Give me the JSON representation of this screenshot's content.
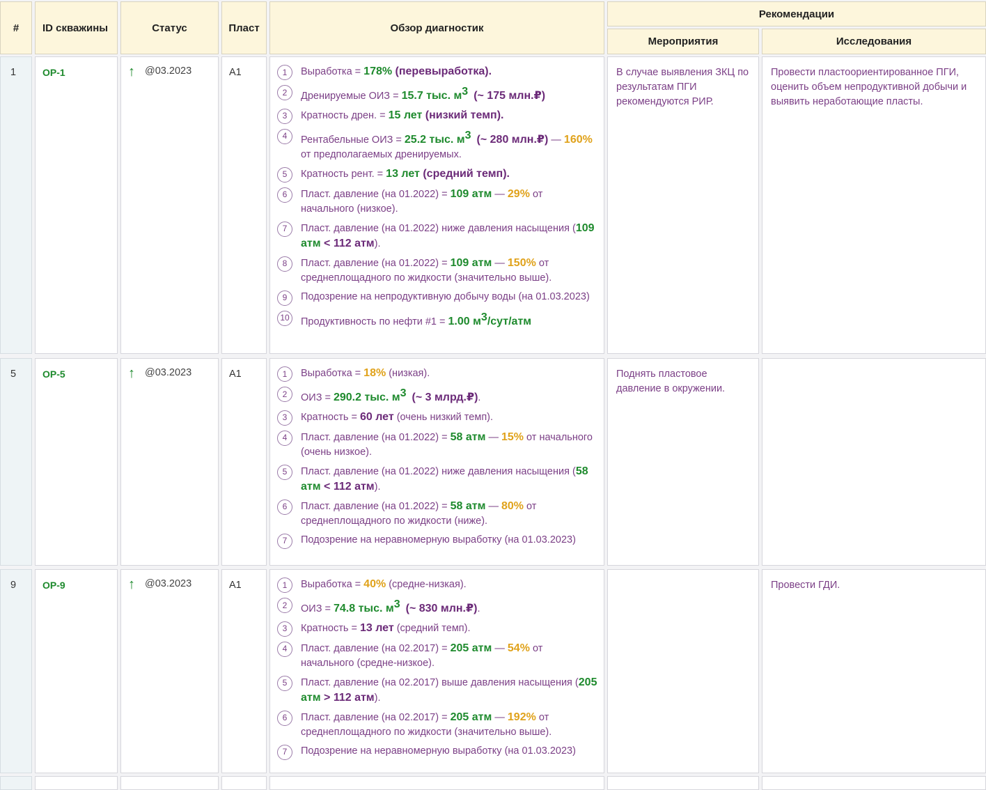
{
  "header": {
    "num": "#",
    "id": "ID скважины",
    "status": "Статус",
    "plast": "Пласт",
    "diag": "Обзор диагностик",
    "rec": "Рекомендации",
    "rec_events": "Мероприятия",
    "rec_research": "Исследования"
  },
  "rows": [
    {
      "num": "1",
      "id": "OP-1",
      "status_date": "@03.2023",
      "plast": "A1",
      "events": "В случае выявления ЗКЦ по результатам ПГИ рекомендуются РИР.",
      "research": "Провести пластоориентированное ПГИ, оценить объем непродуктивной добычи и выявить неработающие пласты.",
      "items": [
        {
          "n": "1",
          "a": "Выработка = ",
          "b": "178%",
          "c": " (перевыработка)."
        },
        {
          "n": "2",
          "a": "Дренируемые ОИЗ = ",
          "b": "15.7 тыс. м",
          "b_sup": "3",
          "c": "(~ 175 млн.₽)"
        },
        {
          "n": "3",
          "a": "Кратность дрен. = ",
          "b": "15 лет",
          "c": " (низкий темп)."
        },
        {
          "n": "4",
          "a": "Рентабельные ОИЗ = ",
          "b": "25.2 тыс. м",
          "b_sup": "3",
          "c": "(~ 280 млн.₽)",
          "d": " — ",
          "e": "160%",
          "f": " от предполагаемых дренируемых."
        },
        {
          "n": "5",
          "a": "Кратность рент. = ",
          "b": "13 лет",
          "c": " (средний темп)."
        },
        {
          "n": "6",
          "a": "Пласт. давление (на 01.2022) = ",
          "b": "109 атм",
          "d": " — ",
          "e": "29%",
          "f": " от начального (низкое)."
        },
        {
          "n": "7",
          "a": "Пласт. давление (на 01.2022) ниже давления насыщения (",
          "b": "109 атм",
          "c": " < 112 атм",
          "f": ")."
        },
        {
          "n": "8",
          "a": "Пласт. давление (на 01.2022) = ",
          "b": "109 атм",
          "d": " — ",
          "e": "150%",
          "f": " от среднеплощадного по жидкости (значительно выше)."
        },
        {
          "n": "9",
          "a": "Подозрение на непродуктивную добычу воды (на 01.03.2023)"
        },
        {
          "n": "10",
          "a": "Продуктивность по нефти #1 = ",
          "b": "1.00 м",
          "b_sup": "3",
          "b2": "/сут/атм"
        }
      ]
    },
    {
      "num": "5",
      "id": "OP-5",
      "status_date": "@03.2023",
      "plast": "A1",
      "events": "Поднять пластовое давление в окружении.",
      "research": "",
      "items": [
        {
          "n": "1",
          "a": "Выработка = ",
          "e": "18%",
          "f": " (низкая)."
        },
        {
          "n": "2",
          "a": "ОИЗ = ",
          "b": "290.2 тыс. м",
          "b_sup": "3",
          "c": "(~ 3 млрд.₽)",
          "f": "."
        },
        {
          "n": "3",
          "a": "Кратность = ",
          "c": "60 лет",
          "f": " (очень низкий темп)."
        },
        {
          "n": "4",
          "a": "Пласт. давление (на 01.2022) = ",
          "b": "58 атм",
          "d": " — ",
          "e": "15%",
          "f": " от начального (очень низкое)."
        },
        {
          "n": "5",
          "a": "Пласт. давление (на 01.2022) ниже давления насыщения (",
          "b": "58 атм",
          "c": " < 112 атм",
          "f": ")."
        },
        {
          "n": "6",
          "a": "Пласт. давление (на 01.2022) = ",
          "b": "58 атм",
          "d": " — ",
          "e": "80%",
          "f": " от среднеплощадного по жидкости (ниже)."
        },
        {
          "n": "7",
          "a": "Подозрение на неравномерную выработку (на 01.03.2023)"
        }
      ]
    },
    {
      "num": "9",
      "id": "OP-9",
      "status_date": "@03.2023",
      "plast": "A1",
      "events": "",
      "research": "Провести ГДИ.",
      "items": [
        {
          "n": "1",
          "a": "Выработка = ",
          "e": "40%",
          "f": " (средне-низкая)."
        },
        {
          "n": "2",
          "a": "ОИЗ = ",
          "b": "74.8 тыс. м",
          "b_sup": "3",
          "c": "(~ 830 млн.₽)",
          "f": "."
        },
        {
          "n": "3",
          "a": "Кратность = ",
          "c": "13 лет",
          "f": " (средний темп)."
        },
        {
          "n": "4",
          "a": "Пласт. давление (на 02.2017) = ",
          "b": "205 атм",
          "d": " — ",
          "e": "54%",
          "f": " от начального (средне-низкое)."
        },
        {
          "n": "5",
          "a": "Пласт. давление (на 02.2017) выше давления насыщения (",
          "b": "205 атм",
          "c": " > 112 атм",
          "f": ")."
        },
        {
          "n": "6",
          "a": "Пласт. давление (на 02.2017) = ",
          "b": "205 атм",
          "d": " — ",
          "e": "192%",
          "f": " от среднеплощадного по жидкости (значительно выше)."
        },
        {
          "n": "7",
          "a": "Подозрение на неравномерную выработку (на 01.03.2023)"
        }
      ]
    }
  ]
}
